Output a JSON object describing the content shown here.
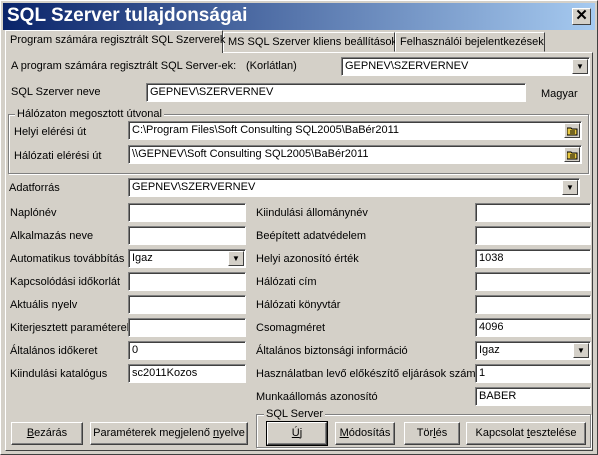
{
  "window": {
    "title": "SQL Szerver tulajdonságai",
    "close_glyph": "✕"
  },
  "tabs": [
    {
      "label": "Program számára regisztrált SQL Szerverek"
    },
    {
      "label": "MS SQL Szerver kliens beállítások"
    },
    {
      "label": "Felhasználói bejelentkezések"
    }
  ],
  "registered": {
    "label": "A program számára regisztrált SQL Server-ek:",
    "limit": "(Korlátlan)",
    "selected": "GEPNEV\\SZERVERNEV"
  },
  "server_name": {
    "label": "SQL Szerver neve",
    "value": "GEPNEV\\SZERVERNEV",
    "language": "Magyar"
  },
  "network_path": {
    "group_title": "Hálózaton megosztott útvonal",
    "local_label": "Helyi elérési út",
    "local_value": "C:\\Program Files\\Soft Consulting SQL2005\\BaBér2011",
    "network_label": "Hálózati elérési út",
    "network_value": "\\\\GEPNEV\\Soft Consulting SQL2005\\BaBér2011"
  },
  "datasource": {
    "label": "Adatforrás",
    "value": "GEPNEV\\SZERVERNEV"
  },
  "left_fields": [
    {
      "label": "Naplónév",
      "value": ""
    },
    {
      "label": "Alkalmazás neve",
      "value": ""
    },
    {
      "label": "Automatikus továbbítás",
      "value": "Igaz"
    },
    {
      "label": "Kapcsolódási időkorlát",
      "value": ""
    },
    {
      "label": "Aktuális nyelv",
      "value": ""
    },
    {
      "label": "Kiterjesztett paraméterek",
      "value": ""
    },
    {
      "label": "Általános időkeret",
      "value": "0"
    },
    {
      "label": "Kiindulási katalógus",
      "value": "sc2011Kozos"
    }
  ],
  "right_fields": [
    {
      "label": "Kiindulási állománynév",
      "value": ""
    },
    {
      "label": "Beépített adatvédelem",
      "value": ""
    },
    {
      "label": "Helyi azonosító érték",
      "value": "1038"
    },
    {
      "label": "Hálózati cím",
      "value": ""
    },
    {
      "label": "Hálózati könyvtár",
      "value": ""
    },
    {
      "label": "Csomagméret",
      "value": "4096"
    },
    {
      "label": "Általános biztonsági információ",
      "value": "Igaz"
    },
    {
      "label": "Használatban levő előkészítő eljárások száma",
      "value": "1"
    },
    {
      "label": "Munkaállomás azonosító",
      "value": "BABER"
    }
  ],
  "buttons": {
    "close_pre": "",
    "close_ul": "B",
    "close_post": "ezárás",
    "params_pre": "Paraméterek megjelenő ",
    "params_ul": "n",
    "params_post": "yelve",
    "sql_group": "SQL Server",
    "new_pre": "",
    "new_ul": "Ú",
    "new_post": "j",
    "modify_pre": "",
    "modify_ul": "M",
    "modify_post": "ódosítás",
    "delete_pre": "Tör",
    "delete_ul": "l",
    "delete_post": "és",
    "test_pre": "Kapcsolat ",
    "test_ul": "t",
    "test_post": "esztelése"
  }
}
